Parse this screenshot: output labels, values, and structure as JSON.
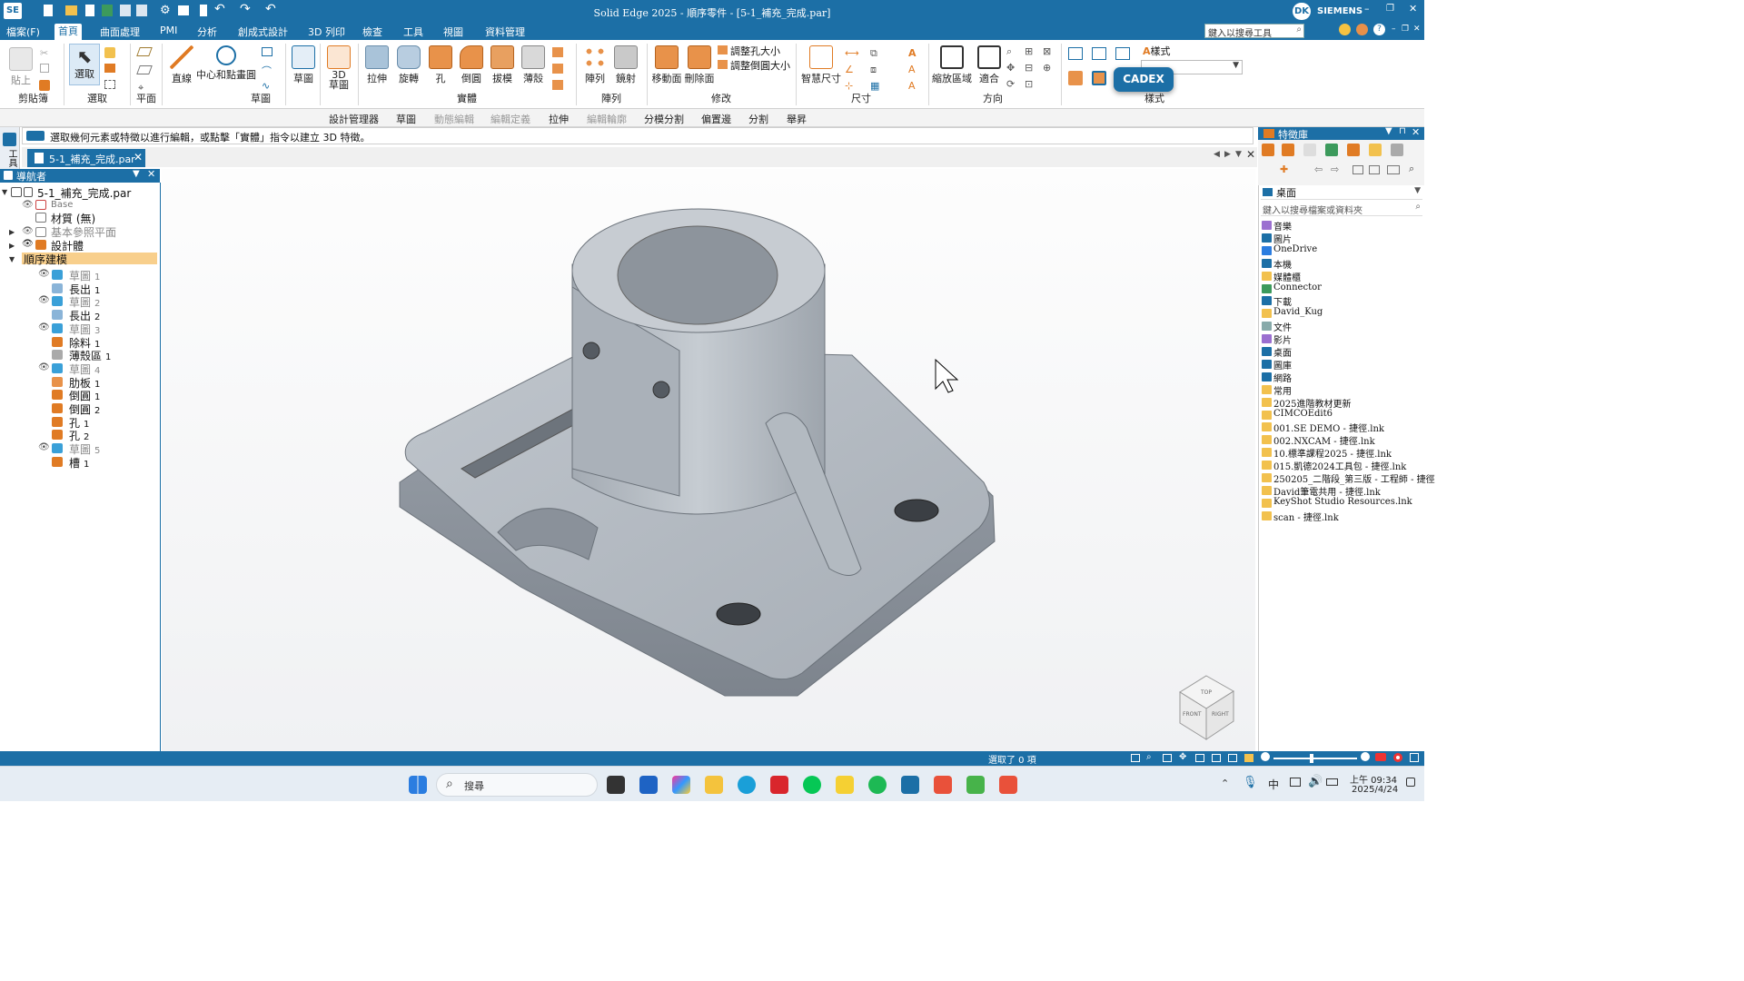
{
  "title": {
    "text": "Solid Edge 2025 - 順序零件 - [5-1_補充_完成.par]",
    "app_badge": "SE",
    "user_initials": "DK",
    "brand": "SIEMENS",
    "search_placeholder": "鍵入以搜尋工具"
  },
  "menu": {
    "file": "檔案(F)",
    "tabs": [
      "首頁",
      "曲面處理",
      "PMI",
      "分析",
      "創成式設計",
      "3D 列印",
      "檢查",
      "工具",
      "視圖",
      "資料管理"
    ]
  },
  "ribbon": {
    "paste": "貼上",
    "clipboard": "剪貼簿",
    "select": "選取",
    "select_group": "選取",
    "plane": "平面",
    "line": "直線",
    "circle": "中心和點畫圓",
    "sketch_group": "草圖",
    "sketch": "草圖",
    "sketch3d_a": "3D",
    "sketch3d_b": "草圖",
    "extrude": "拉伸",
    "revolve": "旋轉",
    "hole": "孔",
    "round": "倒圓",
    "draft": "拔模",
    "thin": "薄殼",
    "solids_group": "實體",
    "pattern": "陣列",
    "mirror": "鏡射",
    "pattern_group": "陣列",
    "move_face": "移動面",
    "delete_face": "刪除面",
    "resize_hole": "調整孔大小",
    "resize_round": "調整倒圓大小",
    "modify_group": "修改",
    "smart_dim": "智慧尺寸",
    "dim_group": "尺寸",
    "zoom_area": "縮放區域",
    "fit": "適合",
    "orient_group": "方向",
    "style_label": "樣式",
    "style_group": "樣式",
    "cadex": "CADEX"
  },
  "cmdbar": [
    "設計管理器",
    "草圖",
    "動態編輯",
    "編輯定義",
    "拉伸",
    "編輯輪廓",
    "分模分割",
    "偏置邊",
    "分割",
    "舉昇"
  ],
  "prompt": "選取幾何元素或特徵以進行編輯，或點擊「實體」指令以建立 3D 特徵。",
  "doc_tab": "5-1_補充_完成.par",
  "left_strip_label": "工具",
  "nav": {
    "title": "導航者",
    "root": "5-1_補充_完成.par",
    "base": "Base",
    "material": "材質 (無)",
    "ref_planes": "基本參照平面",
    "design_body": "設計體",
    "ordered": "順序建模",
    "features": [
      {
        "name": "草圖",
        "num": "1"
      },
      {
        "name": "長出",
        "num": "1"
      },
      {
        "name": "草圖",
        "num": "2"
      },
      {
        "name": "長出",
        "num": "2"
      },
      {
        "name": "草圖",
        "num": "3"
      },
      {
        "name": "除料",
        "num": "1"
      },
      {
        "name": "薄殼區",
        "num": "1"
      },
      {
        "name": "草圖",
        "num": "4"
      },
      {
        "name": "肋板",
        "num": "1"
      },
      {
        "name": "倒圓",
        "num": "1"
      },
      {
        "name": "倒圓",
        "num": "2"
      },
      {
        "name": "孔",
        "num": "1"
      },
      {
        "name": "孔",
        "num": "2"
      },
      {
        "name": "草圖",
        "num": "5"
      },
      {
        "name": "槽",
        "num": "1"
      }
    ]
  },
  "viewcube": {
    "front": "FRONT",
    "right": "RIGHT",
    "top": "TOP"
  },
  "library": {
    "title": "特徵庫",
    "location": "桌面",
    "search_placeholder": "鍵入以搜尋檔案或資料夾",
    "items": [
      "音樂",
      "圖片",
      "OneDrive",
      "本機",
      "媒體櫃",
      "Connector",
      "下載",
      "David_Kug",
      "文件",
      "影片",
      "桌面",
      "圖庫",
      "網路",
      "常用",
      "2025進階教材更新",
      "CIMCOEdit6",
      "001.SE DEMO - 捷徑.lnk",
      "002.NXCAM - 捷徑.lnk",
      "10.標準課程2025 - 捷徑.lnk",
      "015.凱德2024工具包 - 捷徑.lnk",
      "250205_二階段_第三版 - 工程師 - 捷徑",
      "David筆電共用 - 捷徑.lnk",
      "KeyShot Studio Resources.lnk",
      "scan - 捷徑.lnk"
    ]
  },
  "status": {
    "selected": "選取了 0 項"
  },
  "taskbar": {
    "search": "搜尋",
    "ime": "中",
    "time": "上午 09:34",
    "date": "2025/4/24"
  }
}
